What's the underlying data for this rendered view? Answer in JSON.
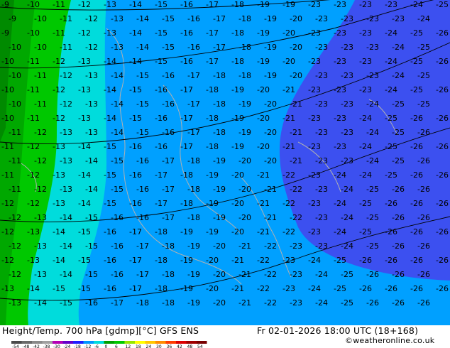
{
  "footer": {
    "title": "Height/Temp. 700 hPa [gdmp][°C] GFS ENS",
    "datetime": "Fr 02-01-2026 18:00 UTC (18+168)",
    "credit": "©weatheronline.co.uk"
  },
  "colorbar": {
    "labels": [
      "-54",
      "-48",
      "-42",
      "-38",
      "-30",
      "-24",
      "-18",
      "-12",
      "-6",
      "0",
      "6",
      "12",
      "18",
      "24",
      "30",
      "36",
      "42",
      "48",
      "54"
    ],
    "colors": [
      "#4a4a4a",
      "#6a6a6a",
      "#8a8a8a",
      "#a0a0a0",
      "#b400b4",
      "#6400c8",
      "#1e1eff",
      "#0096ff",
      "#00dcdc",
      "#00a000",
      "#00c800",
      "#96e600",
      "#ffff00",
      "#ffc800",
      "#ff8c00",
      "#ff3c00",
      "#dc0000",
      "#a00000",
      "#780000"
    ]
  },
  "map": {
    "colors": {
      "temp_m19": "#008a00",
      "temp_m18": "#00a800",
      "temp_m17": "#00c800",
      "temp_m16_m12": "#00dcdc",
      "temp_m24_m18": "#00a0ff",
      "temp_m30_m24": "#3c50f0",
      "coast": "#b0b0b0",
      "contour": "#000000"
    },
    "contour_labels": [
      {
        "text": "-9"
      },
      {
        "text": "-10"
      },
      {
        "text": "-11"
      },
      {
        "text": "-12"
      },
      {
        "text": "-13"
      },
      {
        "text": "-14"
      },
      {
        "text": "-15"
      },
      {
        "text": "-16"
      },
      {
        "text": "-17"
      },
      {
        "text": "-18"
      },
      {
        "text": "-19"
      },
      {
        "text": "-20"
      },
      {
        "text": "-21"
      },
      {
        "text": "-22"
      },
      {
        "text": "-23"
      },
      {
        "text": "-24"
      },
      {
        "text": "-25"
      },
      {
        "text": "-26"
      }
    ]
  }
}
